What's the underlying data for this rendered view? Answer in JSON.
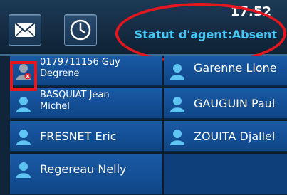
{
  "header": {
    "time": "17:52",
    "agent_status": "Statut d'agent:Absent"
  },
  "icons": {
    "messages": "envelope-icon",
    "history": "clock-icon"
  },
  "colors": {
    "header_bg": "#152c43",
    "status_text": "#44c7f4",
    "contact_bg": "#1a5aa6",
    "annotation_red": "#e3171d"
  },
  "contacts": {
    "left": [
      {
        "line1": "0179711156 Guy",
        "line2": "Degrene",
        "status": "unavailable"
      },
      {
        "line1": "BASQUIAT Jean",
        "line2": "Michel",
        "status": "available"
      },
      {
        "line1": "FRESNET Eric",
        "status": "available"
      },
      {
        "line1": "Regereau Nelly",
        "status": "available"
      }
    ],
    "right": [
      {
        "line1": "Garenne Lione",
        "status": "available"
      },
      {
        "line1": "GAUGUIN Paul",
        "status": "available"
      },
      {
        "line1": "ZOUITA Djallel",
        "status": "available"
      }
    ]
  }
}
